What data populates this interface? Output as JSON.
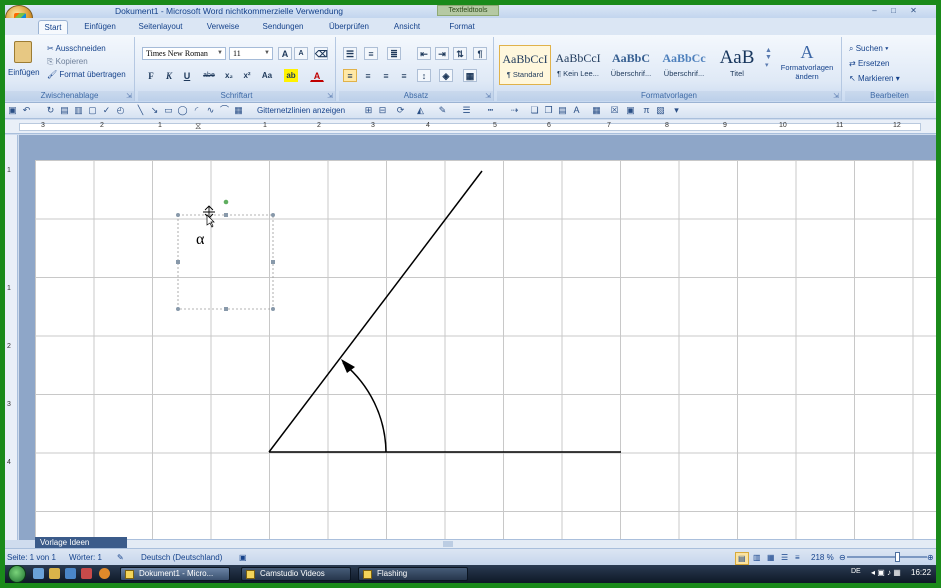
{
  "window": {
    "title": "Dokument1 - Microsoft Word nichtkommerzielle Verwendung",
    "tools_tab": "Textfeldtools",
    "controls": {
      "minimize": "–",
      "maximize": "□",
      "close": "✕"
    }
  },
  "tabs": [
    {
      "label": "Start",
      "active": true
    },
    {
      "label": "Einfügen"
    },
    {
      "label": "Seitenlayout"
    },
    {
      "label": "Verweise"
    },
    {
      "label": "Sendungen"
    },
    {
      "label": "Überprüfen"
    },
    {
      "label": "Ansicht"
    },
    {
      "label": "Format"
    }
  ],
  "ribbon": {
    "clipboard": {
      "label": "Zwischenablage",
      "paste": "Einfügen",
      "cut": "Ausschneiden",
      "copy": "Kopieren",
      "format_painter": "Format übertragen"
    },
    "font": {
      "label": "Schriftart",
      "font_name": "Times New Roman",
      "font_size": "11",
      "bold": "F",
      "italic": "K",
      "underline": "U",
      "strike": "abe",
      "subscript": "x₂",
      "superscript": "x²",
      "change_case": "Aa",
      "grow": "A",
      "shrink": "A"
    },
    "paragraph": {
      "label": "Absatz"
    },
    "styles": {
      "label": "Formatvorlagen",
      "items": [
        {
          "sample": "AaBbCcI",
          "name": "¶ Standard",
          "selected": true
        },
        {
          "sample": "AaBbCcI",
          "name": "¶ Kein Lee..."
        },
        {
          "sample": "AaBbC",
          "name": "Überschrif..."
        },
        {
          "sample": "AaBbCc",
          "name": "Überschrif..."
        },
        {
          "sample": "AaB",
          "name": "Titel"
        }
      ],
      "change_styles": "Formatvorlagen ändern"
    },
    "editing": {
      "label": "Bearbeiten",
      "find": "Suchen",
      "replace": "Ersetzen",
      "select": "Markieren"
    }
  },
  "toolbar2": {
    "gridlines": "Gitternetzlinien anzeigen"
  },
  "ruler": {
    "h_numbers": [
      "3",
      "2",
      "1",
      "1",
      "2",
      "3",
      "4",
      "5",
      "6",
      "7",
      "8",
      "9",
      "10",
      "11",
      "12"
    ],
    "v_numbers": [
      "1",
      "1",
      "2",
      "3",
      "4"
    ]
  },
  "document": {
    "alpha": "α",
    "template_tab": "Vorlage Ideen"
  },
  "status": {
    "page": "Seite: 1 von 1",
    "words": "Wörter: 1",
    "language": "Deutsch (Deutschland)",
    "zoom": "218 %"
  },
  "taskbar": {
    "items": [
      {
        "label": "Dokument1 - Micro...",
        "active": true
      },
      {
        "label": "Camstudio Videos"
      },
      {
        "label": "Flashing"
      }
    ],
    "lang": "DE",
    "clock": "16:22"
  }
}
